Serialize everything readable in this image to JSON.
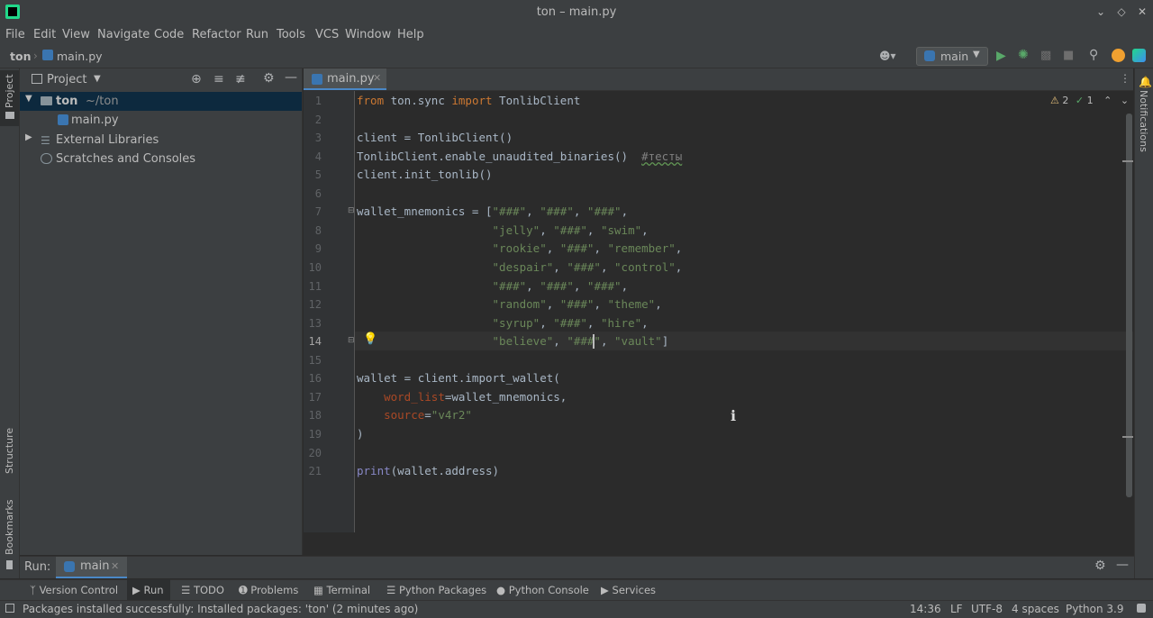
{
  "window": {
    "title": "ton – main.py"
  },
  "menu": [
    "File",
    "Edit",
    "View",
    "Navigate",
    "Code",
    "Refactor",
    "Run",
    "Tools",
    "VCS",
    "Window",
    "Help"
  ],
  "breadcrumb": {
    "project": "ton",
    "file": "main.py"
  },
  "run_config": {
    "label": "main"
  },
  "left_strip": {
    "project": "Project",
    "structure": "Structure",
    "bookmarks": "Bookmarks"
  },
  "right_strip": {
    "notifications": "Notifications"
  },
  "project_panel": {
    "title": "Project",
    "tree": [
      {
        "name": "ton",
        "path": "~/ton"
      },
      {
        "name": "main.py"
      },
      {
        "name": "External Libraries"
      },
      {
        "name": "Scratches and Consoles"
      }
    ]
  },
  "editor": {
    "tab": "main.py",
    "inspections": {
      "warnings": "2",
      "ok": "1"
    },
    "lines": [
      "1",
      "2",
      "3",
      "4",
      "5",
      "6",
      "7",
      "8",
      "9",
      "10",
      "11",
      "12",
      "13",
      "14",
      "15",
      "16",
      "17",
      "18",
      "19",
      "20",
      "21"
    ],
    "current_line": "14"
  },
  "run_panel": {
    "label": "Run:",
    "config": "main"
  },
  "tool_tabs": [
    "Version Control",
    "Run",
    "TODO",
    "Problems",
    "Terminal",
    "Python Packages",
    "Python Console",
    "Services"
  ],
  "status": {
    "message": "Packages installed successfully: Installed packages: 'ton' (2 minutes ago)",
    "position": "14:36",
    "line_sep": "LF",
    "encoding": "UTF-8",
    "indent": "4 spaces",
    "interpreter": "Python 3.9"
  },
  "colors": {
    "accent": "#4a88c7",
    "selection": "#0d293e",
    "keyword": "#cc7832",
    "string": "#6a8759"
  }
}
